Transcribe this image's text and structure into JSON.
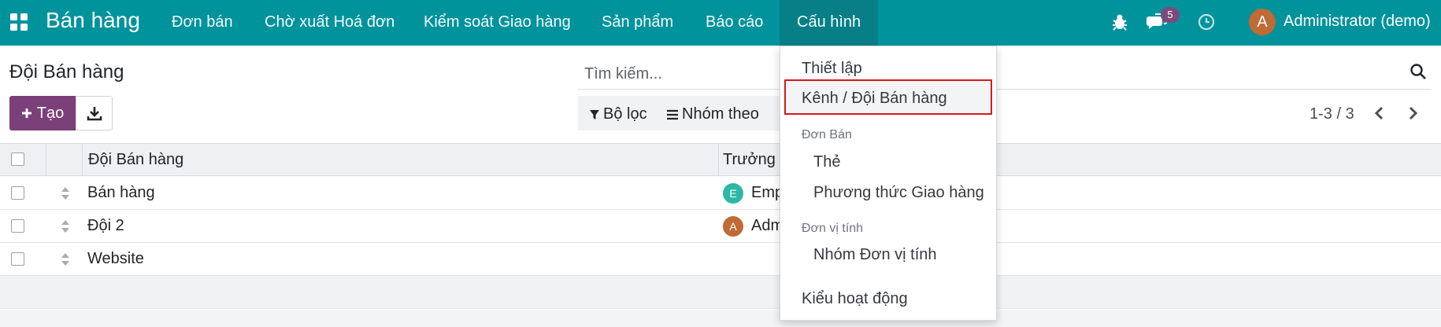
{
  "navbar": {
    "app_title": "Bán hàng",
    "menu": [
      "Đơn bán",
      "Chờ xuất Hoá đơn",
      "Kiểm soát Giao hàng",
      "Sản phẩm",
      "Báo cáo",
      "Cấu hình"
    ],
    "active_menu": "Cấu hình",
    "messages_count": "5",
    "user_initial": "A",
    "user_name": "Administrator (demo)",
    "colors": {
      "bar": "#00939c",
      "active": "#087f87",
      "badge": "#7c4a7c",
      "avatar": "#c06a35"
    },
    "icons": [
      "apps-grid-icon",
      "bug-icon",
      "chat-icon",
      "clock-icon"
    ]
  },
  "control_panel": {
    "title": "Đội Bán hàng",
    "create_label": "Tạo",
    "search_placeholder": "Tìm kiếm...",
    "filter_label": "Bộ lọc",
    "group_label": "Nhóm theo",
    "pager": "1-3 / 3",
    "create_color": "#7b3f7a"
  },
  "list": {
    "columns": [
      "Đội Bán hàng",
      "Trưởng"
    ],
    "rows": [
      {
        "name": "Bán hàng",
        "leader_initial": "E",
        "leader": "Emp",
        "avatar_color": "#2fb7a5"
      },
      {
        "name": "Đội 2",
        "leader_initial": "A",
        "leader": "Adm",
        "avatar_color": "#c06a35"
      },
      {
        "name": "Website",
        "leader_initial": "",
        "leader": "",
        "avatar_color": ""
      }
    ]
  },
  "dropdown": {
    "settings": "Thiết lập",
    "teams": "Kênh / Đội Bán hàng",
    "section_orders": "Đơn Bán",
    "tags": "Thẻ",
    "delivery_methods": "Phương thức Giao hàng",
    "section_uom": "Đơn vị tính",
    "uom_categories": "Nhóm Đơn vị tính",
    "activity_types": "Kiểu hoạt động",
    "highlight_color": "#d7191c"
  }
}
